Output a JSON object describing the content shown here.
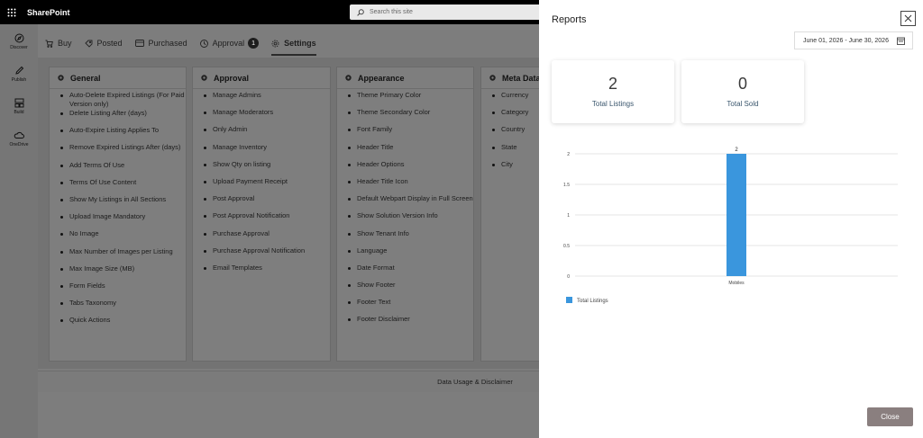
{
  "topbar": {
    "app_name": "SharePoint",
    "search_placeholder": "Search this site"
  },
  "rail": [
    {
      "label": "Discover",
      "icon": "compass-icon"
    },
    {
      "label": "Publish",
      "icon": "pen-icon"
    },
    {
      "label": "Build",
      "icon": "grid-icon"
    },
    {
      "label": "OneDrive",
      "icon": "cloud-icon"
    }
  ],
  "tabs": [
    {
      "label": "Buy",
      "icon": "cart-icon"
    },
    {
      "label": "Posted",
      "icon": "tag-icon"
    },
    {
      "label": "Purchased",
      "icon": "card-icon"
    },
    {
      "label": "Approval",
      "icon": "clock-icon",
      "badge": "1"
    },
    {
      "label": "Settings",
      "icon": "gear-icon",
      "active": true
    }
  ],
  "sections": {
    "general": {
      "title": "General",
      "items": [
        "Auto-Delete Expired Listings (For Paid Version only)",
        "Delete Listing After (days)",
        "Auto-Expire Listing Applies To",
        "Remove Expired Listings After (days)",
        "Add Terms Of Use",
        "Terms Of Use Content",
        "Show My Listings in All Sections",
        "Upload Image Mandatory",
        "No Image",
        "Max Number of Images per Listing",
        "Max Image Size (MB)",
        "Form Fields",
        "Tabs Taxonomy",
        "Quick Actions"
      ]
    },
    "approval": {
      "title": "Approval",
      "items": [
        "Manage Admins",
        "Manage Moderators",
        "Only Admin",
        "Manage Inventory",
        "Show Qty on listing",
        "Upload Payment Receipt",
        "Post Approval",
        "Post Approval Notification",
        "Purchase Approval",
        "Purchase Approval Notification",
        "Email Templates"
      ]
    },
    "appearance": {
      "title": "Appearance",
      "items": [
        "Theme Primary Color",
        "Theme Secondary Color",
        "Font Family",
        "Header Title",
        "Header Options",
        "Header Title Icon",
        "Default Webpart Display in Full Screen",
        "Show Solution Version Info",
        "Show Tenant Info",
        "Language",
        "Date Format",
        "Show Footer",
        "Footer Text",
        "Footer Disclaimer"
      ]
    },
    "metadata": {
      "title": "Meta Data",
      "items": [
        "Currency",
        "Category",
        "Country",
        "State",
        "City"
      ]
    }
  },
  "footer_link": "Data Usage & Disclaimer",
  "reports": {
    "title": "Reports",
    "date_range": "June 01, 2026 - June 30, 2026",
    "stats": [
      {
        "value": "2",
        "label": "Total Listings"
      },
      {
        "value": "0",
        "label": "Total Sold"
      }
    ],
    "close_label": "Close"
  },
  "chart_data": {
    "type": "bar",
    "categories": [
      "Mobiles"
    ],
    "series": [
      {
        "name": "Total Listings",
        "values": [
          2
        ],
        "color": "#3a96dd"
      }
    ],
    "ylim": [
      0,
      2
    ],
    "yticks": [
      "0",
      "0.5",
      "1",
      "1.5",
      "2"
    ],
    "data_labels": [
      "2"
    ],
    "grid": true,
    "legend": "bottom-left"
  }
}
